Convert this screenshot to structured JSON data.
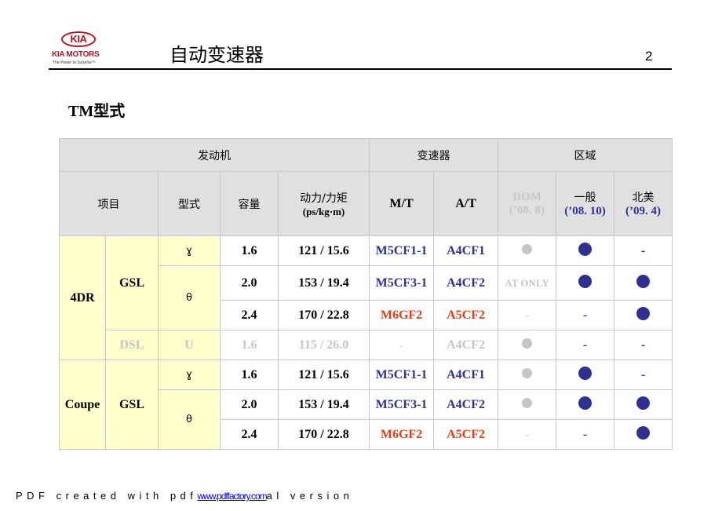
{
  "header": {
    "logo": {
      "emblem": "KIA",
      "brand": "KIA MOTORS",
      "tagline": "The Power to Surprise™"
    },
    "title": "自动变速器",
    "page_number": "2"
  },
  "subtitle": "TM型式",
  "table": {
    "group_headers": {
      "engine": "发动机",
      "transmission": "变速器",
      "region": "区域"
    },
    "columns": {
      "item": "项目",
      "type": "型式",
      "capacity": "容量",
      "power_torque": "动力/力矩",
      "power_torque_unit": "(ps/kg·m)",
      "mt": "M/T",
      "at": "A/T",
      "dom": "DOM",
      "dom_date": "(’08. 8)",
      "general": "一般",
      "general_date": "(’08. 10)",
      "na": "北美",
      "na_date": "(’09. 4)"
    },
    "groups": [
      {
        "body": "4DR",
        "fuels": [
          {
            "fuel": "GSL",
            "engines": [
              {
                "type": "ɣ",
                "rows": [
                  {
                    "capacity": "1.6",
                    "power_torque": "121 / 15.6",
                    "mt": "M5CF1-1",
                    "at": "A4CF1",
                    "dom": "dot-gray",
                    "general": "dot",
                    "na": "-"
                  }
                ]
              },
              {
                "type": "θ",
                "rows": [
                  {
                    "capacity": "2.0",
                    "power_torque": "153 / 19.4",
                    "mt": "M5CF3-1",
                    "at": "A4CF2",
                    "dom": "AT ONLY",
                    "general": "dot",
                    "na": "dot"
                  },
                  {
                    "capacity": "2.4",
                    "power_torque": "170 / 22.8",
                    "mt": "M6GF2",
                    "at": "A5CF2",
                    "dom": "-",
                    "general": "-",
                    "na": "dot"
                  }
                ]
              }
            ]
          },
          {
            "fuel": "DSL",
            "engines": [
              {
                "type": "U",
                "rows": [
                  {
                    "capacity": "1.6",
                    "power_torque": "115 / 26.0",
                    "mt": "-",
                    "at": "A4CF2",
                    "dom": "dot-gray",
                    "general": "-",
                    "na": "-"
                  }
                ]
              }
            ]
          }
        ]
      },
      {
        "body": "Coupe",
        "fuels": [
          {
            "fuel": "GSL",
            "engines": [
              {
                "type": "ɣ",
                "rows": [
                  {
                    "capacity": "1.6",
                    "power_torque": "121 / 15.6",
                    "mt": "M5CF1-1",
                    "at": "A4CF1",
                    "dom": "dot-gray",
                    "general": "dot",
                    "na": "-"
                  }
                ]
              },
              {
                "type": "θ",
                "rows": [
                  {
                    "capacity": "2.0",
                    "power_torque": "153 / 19.4",
                    "mt": "M5CF3-1",
                    "at": "A4CF2",
                    "dom": "dot-gray",
                    "general": "dot",
                    "na": "dot"
                  },
                  {
                    "capacity": "2.4",
                    "power_torque": "170 / 22.8",
                    "mt": "M6GF2",
                    "at": "A5CF2",
                    "dom": "-",
                    "general": "-",
                    "na": "dot"
                  }
                ]
              }
            ]
          }
        ]
      }
    ]
  },
  "colors": {
    "blue": "#2e3192",
    "red": "#ee3a10",
    "gray": "#c6c6c6",
    "header_bg": "#e0e0e0",
    "yellow_bg": "#ffffcc",
    "kia_red": "#c1121f"
  },
  "footer": {
    "prefix": "PDF created with pdf",
    "link": "www.pdffactory.com",
    "suffix": "al version"
  }
}
